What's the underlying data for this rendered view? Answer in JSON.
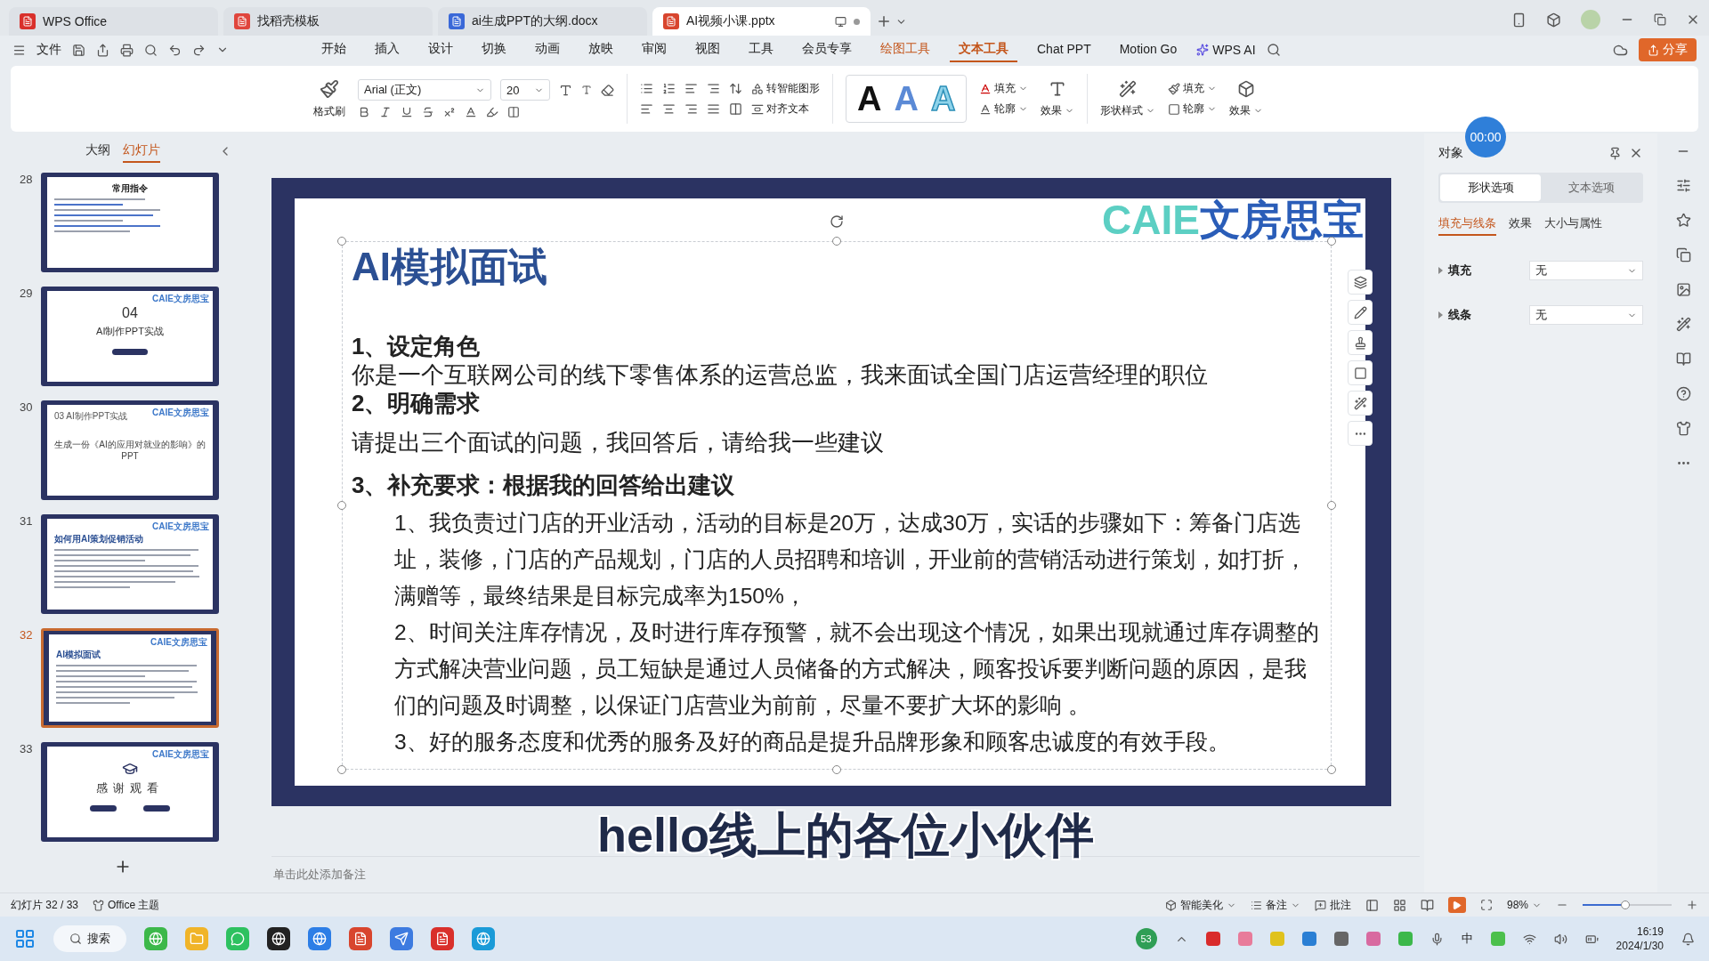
{
  "window_tabs": [
    {
      "label": "WPS Office",
      "kind": "wps",
      "selected": false
    },
    {
      "label": "找稻壳模板",
      "kind": "template",
      "selected": false
    },
    {
      "label": "ai生成PPT的大纲.docx",
      "kind": "doc",
      "selected": false
    },
    {
      "label": "AI视频小课.pptx",
      "kind": "ppt",
      "selected": true
    }
  ],
  "menu": {
    "file": "文件",
    "tabs": [
      {
        "label": "开始",
        "kind": "main",
        "selected": false
      },
      {
        "label": "插入",
        "kind": "main",
        "selected": false
      },
      {
        "label": "设计",
        "kind": "main",
        "selected": false
      },
      {
        "label": "切换",
        "kind": "main",
        "selected": false
      },
      {
        "label": "动画",
        "kind": "main",
        "selected": false
      },
      {
        "label": "放映",
        "kind": "main",
        "selected": false
      },
      {
        "label": "审阅",
        "kind": "main",
        "selected": false
      },
      {
        "label": "视图",
        "kind": "main",
        "selected": false
      },
      {
        "label": "工具",
        "kind": "main",
        "selected": false
      },
      {
        "label": "会员专享",
        "kind": "main",
        "selected": false
      },
      {
        "label": "绘图工具",
        "kind": "context",
        "selected": false
      },
      {
        "label": "文本工具",
        "kind": "context",
        "selected": true
      },
      {
        "label": "Chat PPT",
        "kind": "main",
        "selected": false
      },
      {
        "label": "Motion Go",
        "kind": "main",
        "selected": false
      }
    ],
    "ai": "WPS AI",
    "share": "分享"
  },
  "ribbon": {
    "format_painter": "格式刷",
    "font": "Arial (正文)",
    "size": "20",
    "smart_art": "转智能图形",
    "align_text": "对齐文本",
    "styles": [
      {
        "letter": "A",
        "kind": "solid"
      },
      {
        "letter": "A",
        "kind": "gradient"
      },
      {
        "letter": "A",
        "kind": "outline"
      }
    ],
    "text_fill": "填充",
    "text_outline": "轮廓",
    "text_effect": "效果",
    "shape_style": "形状样式",
    "shape_fill": "填充",
    "shape_outline": "轮廓",
    "shape_effect": "效果"
  },
  "slides_panel": {
    "tabs": [
      {
        "label": "大纲",
        "selected": false
      },
      {
        "label": "幻灯片",
        "selected": true
      }
    ],
    "slides": [
      {
        "number": "28",
        "kind": "list",
        "title": "常用指令",
        "selected": false
      },
      {
        "number": "29",
        "kind": "section",
        "logo": "CAIE文房思宝",
        "index": "04",
        "title": "AI制作PPT实战",
        "selected": false
      },
      {
        "number": "30",
        "kind": "statement",
        "logo": "CAIE文房思宝",
        "header": "03 AI制作PPT实战",
        "title": "生成一份《AI的应用对就业的影响》的PPT",
        "selected": false
      },
      {
        "number": "31",
        "kind": "text",
        "logo": "CAIE文房思宝",
        "title": "如何用AI策划促销活动",
        "selected": false
      },
      {
        "number": "32",
        "kind": "text",
        "logo": "CAIE文房思宝",
        "title": "AI模拟面试",
        "selected": true
      },
      {
        "number": "33",
        "kind": "end",
        "logo": "CAIE文房思宝",
        "title": "感谢观看",
        "selected": false
      }
    ]
  },
  "slide": {
    "logo": {
      "latin": "CAIE",
      "cjk": "文房思宝"
    },
    "title": "AI模拟面试",
    "blocks": [
      {
        "kind": "heading",
        "text": "1、设定角色"
      },
      {
        "kind": "line",
        "text": "你是一个互联网公司的线下零售体系的运营总监，我来面试全国门店运营经理的职位"
      },
      {
        "kind": "heading",
        "text": "2、明确需求"
      },
      {
        "kind": "line",
        "text": "请提出三个面试的问题，我回答后，请给我一些建议"
      },
      {
        "kind": "heading",
        "text": "3、补充要求：根据我的回答给出建议"
      },
      {
        "kind": "item",
        "text": "1、我负责过门店的开业活动，活动的目标是20万，达成30万，实话的步骤如下：筹备门店选址，装修，门店的产品规划，门店的人员招聘和培训，开业前的营销活动进行策划，如打折，满赠等，最终结果是目标完成率为150%，"
      },
      {
        "kind": "item",
        "text": "2、时间关注库存情况，及时进行库存预警，就不会出现这个情况，如果出现就通过库存调整的方式解决营业问题，员工短缺是通过人员储备的方式解决，顾客投诉要判断问题的原因，是我们的问题及时调整，以保证门店营业为前前，尽量不要扩大坏的影响 。"
      },
      {
        "kind": "item",
        "text": "3、好的服务态度和优秀的服务及好的商品是提升品牌形象和顾客忠诚度的有效手段。"
      }
    ]
  },
  "notes_placeholder": "单击此处添加备注",
  "caption": "hello线上的各位小伙伴",
  "timer": "00:00",
  "properties": {
    "title": "对象",
    "tabs": [
      {
        "label": "形状选项",
        "selected": true
      },
      {
        "label": "文本选项",
        "selected": false
      }
    ],
    "subtabs": [
      {
        "label": "填充与线条",
        "selected": true
      },
      {
        "label": "效果",
        "selected": false
      },
      {
        "label": "大小与属性",
        "selected": false
      }
    ],
    "rows": [
      {
        "label": "填充",
        "value": "无"
      },
      {
        "label": "线条",
        "value": "无"
      }
    ]
  },
  "status": {
    "slide": "幻灯片 32 / 33",
    "theme": "Office 主题",
    "beautify": "智能美化",
    "notes": "备注",
    "comments": "批注",
    "zoom": "98%",
    "zoom_level": {
      "level": 0.48
    }
  },
  "taskbar": {
    "search": "搜索",
    "badge": "53",
    "ime": "中",
    "time": "16:19",
    "date": "2024/1/30"
  }
}
